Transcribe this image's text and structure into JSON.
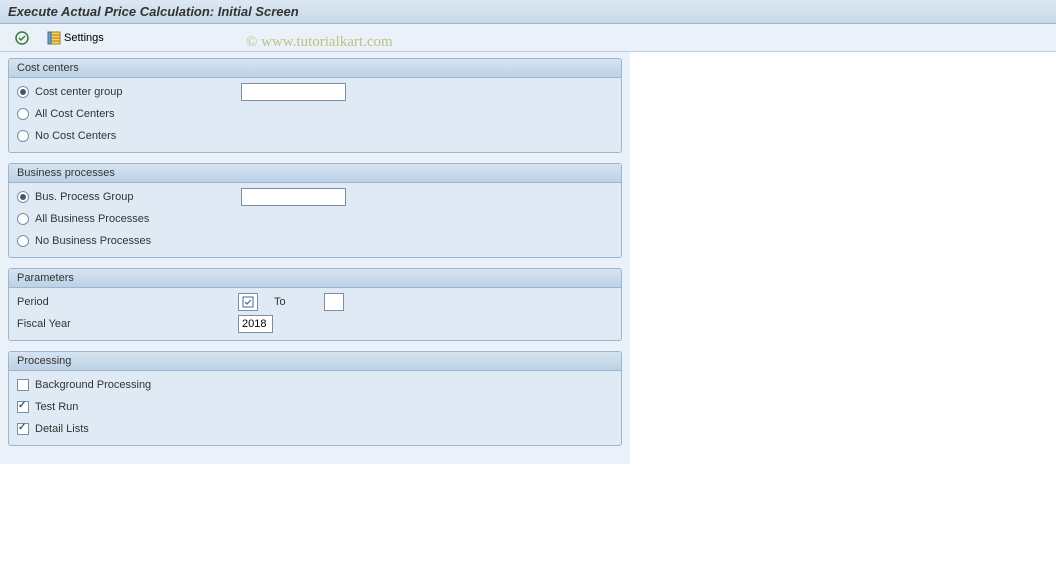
{
  "title": "Execute Actual Price Calculation: Initial Screen",
  "watermark": "© www.tutorialkart.com",
  "toolbar": {
    "settings_label": "Settings"
  },
  "groups": {
    "cost_centers": {
      "title": "Cost centers",
      "group_label": "Cost center group",
      "group_value": "",
      "all_label": "All Cost Centers",
      "none_label": "No Cost Centers",
      "selected": "group"
    },
    "business_processes": {
      "title": "Business processes",
      "group_label": "Bus. Process Group",
      "group_value": "",
      "all_label": "All Business Processes",
      "none_label": "No Business Processes",
      "selected": "group"
    },
    "parameters": {
      "title": "Parameters",
      "period_label": "Period",
      "period_from": "",
      "to_label": "To",
      "period_to": "",
      "fiscal_year_label": "Fiscal Year",
      "fiscal_year_value": "2018"
    },
    "processing": {
      "title": "Processing",
      "background_label": "Background Processing",
      "background_checked": false,
      "testrun_label": "Test Run",
      "testrun_checked": true,
      "detail_label": "Detail Lists",
      "detail_checked": true
    }
  }
}
